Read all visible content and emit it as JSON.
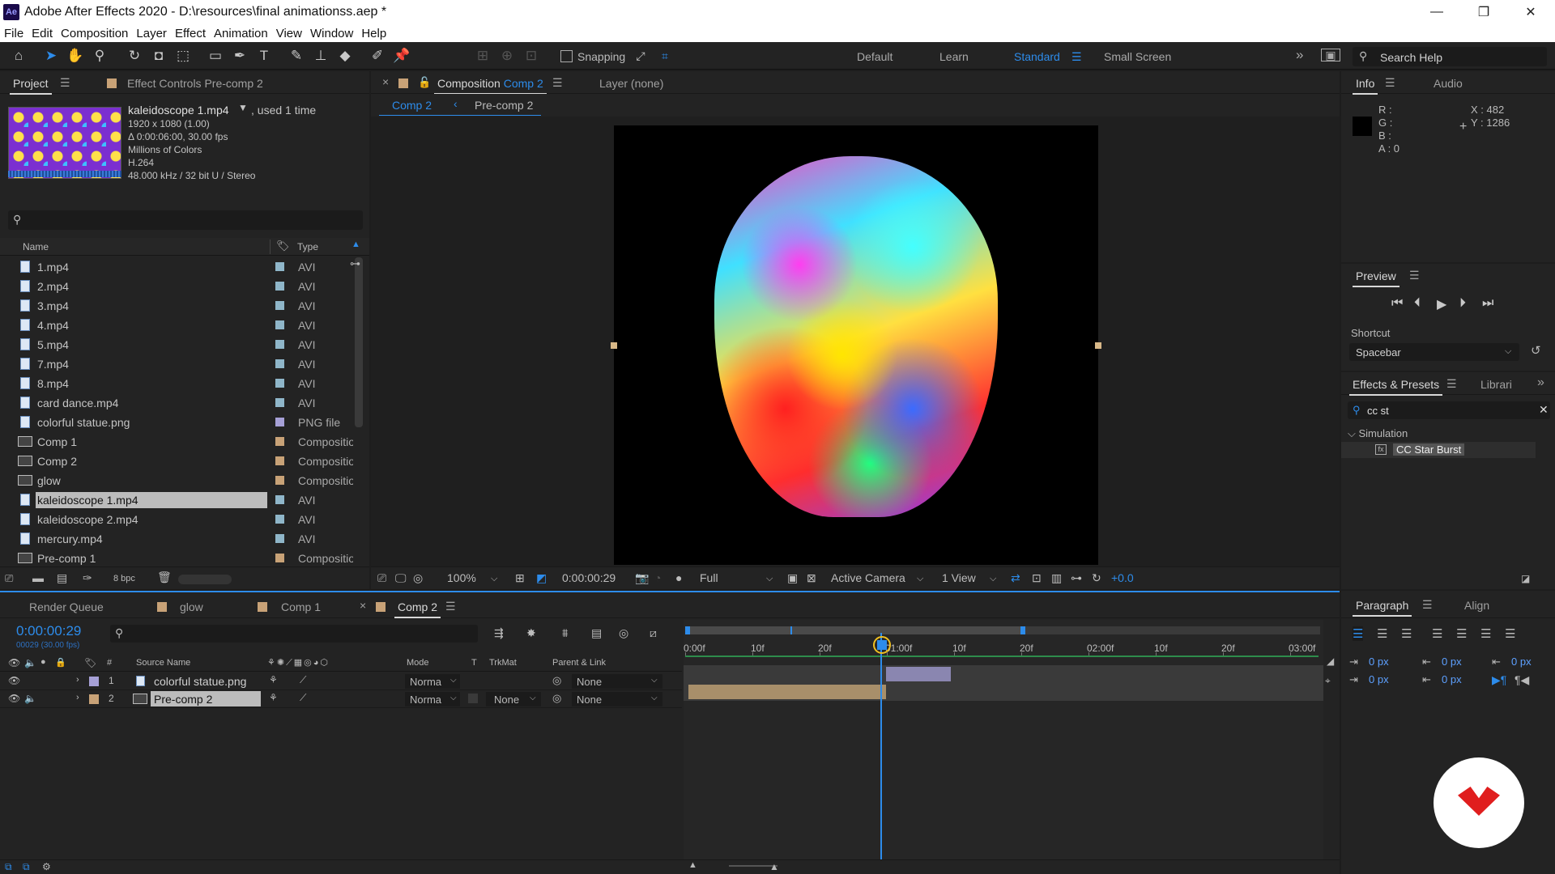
{
  "window": {
    "app_icon": "Ae",
    "title": "Adobe After Effects 2020 - D:\\resources\\final animationss.aep *",
    "minimize": "—",
    "maximize": "❐",
    "close": "✕"
  },
  "menu": [
    "File",
    "Edit",
    "Composition",
    "Layer",
    "Effect",
    "Animation",
    "View",
    "Window",
    "Help"
  ],
  "toolbar": {
    "snapping_label": "Snapping",
    "workspaces": [
      "Default",
      "Learn",
      "Standard",
      "Small Screen"
    ],
    "active_workspace": "Standard",
    "more": "»",
    "search_placeholder": "Search Help"
  },
  "project_panel": {
    "tab": "Project",
    "effect_controls_tab": "Effect Controls Pre-comp 2",
    "selected": {
      "name": "kaleidoscope 1.mp4",
      "used": ", used 1 time",
      "info": [
        "1920 x 1080 (1.00)",
        "Δ 0:00:06:00, 30.00 fps",
        "Millions of Colors",
        "H.264",
        "48.000 kHz / 32 bit U / Stereo"
      ]
    },
    "search_placeholder": "",
    "col_name": "Name",
    "col_type": "Type",
    "items": [
      {
        "name": "1.mp4",
        "type": "AVI",
        "kind": "file",
        "label": "#8fb6c9"
      },
      {
        "name": "2.mp4",
        "type": "AVI",
        "kind": "file",
        "label": "#8fb6c9"
      },
      {
        "name": "3.mp4",
        "type": "AVI",
        "kind": "file",
        "label": "#8fb6c9"
      },
      {
        "name": "4.mp4",
        "type": "AVI",
        "kind": "file",
        "label": "#8fb6c9"
      },
      {
        "name": "5.mp4",
        "type": "AVI",
        "kind": "file",
        "label": "#8fb6c9"
      },
      {
        "name": "7.mp4",
        "type": "AVI",
        "kind": "file",
        "label": "#8fb6c9"
      },
      {
        "name": "8.mp4",
        "type": "AVI",
        "kind": "file",
        "label": "#8fb6c9"
      },
      {
        "name": "card dance.mp4",
        "type": "AVI",
        "kind": "file",
        "label": "#8fb6c9"
      },
      {
        "name": "colorful statue.png",
        "type": "PNG file",
        "kind": "file",
        "label": "#a6a0d6"
      },
      {
        "name": "Comp 1",
        "type": "Composition",
        "kind": "comp",
        "label": "#c8a277"
      },
      {
        "name": "Comp 2",
        "type": "Composition",
        "kind": "comp",
        "label": "#c8a277"
      },
      {
        "name": "glow",
        "type": "Composition",
        "kind": "comp",
        "label": "#c8a277"
      },
      {
        "name": "kaleidoscope 1.mp4",
        "type": "AVI",
        "kind": "file",
        "label": "#8fb6c9",
        "selected": true
      },
      {
        "name": "kaleidoscope 2.mp4",
        "type": "AVI",
        "kind": "file",
        "label": "#8fb6c9"
      },
      {
        "name": "mercury.mp4",
        "type": "AVI",
        "kind": "file",
        "label": "#8fb6c9"
      },
      {
        "name": "Pre-comp 1",
        "type": "Composition",
        "kind": "comp",
        "label": "#c8a277"
      }
    ],
    "bpc": "8 bpc"
  },
  "comp_panel": {
    "tab_prefix": "Composition",
    "tab_comp": "Comp 2",
    "layer_tab": "Layer  (none)",
    "breadcrumbs": [
      "Comp 2",
      "Pre-comp 2"
    ],
    "zoom": "100%",
    "timecode": "0:00:00:29",
    "resolution": "Full",
    "camera": "Active Camera",
    "views": "1 View",
    "exposure": "+0.0"
  },
  "info_panel": {
    "tab": "Info",
    "audio_tab": "Audio",
    "r": "R :",
    "g": "G :",
    "b": "B :",
    "a": "A :  0",
    "x": "X : 482",
    "y": "Y : 1286"
  },
  "preview_panel": {
    "tab": "Preview",
    "shortcut_label": "Shortcut",
    "shortcut_value": "Spacebar"
  },
  "effects_panel": {
    "tab": "Effects & Presets",
    "libraries_tab": "Librari",
    "search_value": "cc st",
    "category": "Simulation",
    "effect": "CC Star Burst"
  },
  "paragraph_panel": {
    "tab": "Paragraph",
    "align_tab": "Align",
    "indent_values": [
      "0 px",
      "0 px",
      "0 px",
      "0 px",
      "0 px"
    ]
  },
  "timeline": {
    "tabs": [
      "Render Queue",
      "glow",
      "Comp 1",
      "Comp 2"
    ],
    "active_tab": "Comp 2",
    "timecode": "0:00:00:29",
    "frame_info": "00029 (30.00 fps)",
    "columns": {
      "source": "Source Name",
      "mode": "Mode",
      "t": "T",
      "trkmat": "TrkMat",
      "parent": "Parent & Link"
    },
    "ruler": [
      "0:00f",
      "10f",
      "20f",
      "01:00f",
      "10f",
      "20f",
      "02:00f",
      "10f",
      "20f",
      "03:00f"
    ],
    "layers": [
      {
        "num": "1",
        "name": "colorful statue.png",
        "mode": "Norma",
        "trkmat": "",
        "parent": "None",
        "label": "#a6a0d6"
      },
      {
        "num": "2",
        "name": "Pre-comp 2",
        "mode": "Norma",
        "trkmat": "None",
        "parent": "None",
        "label": "#c8a277"
      }
    ]
  },
  "colors": {
    "accent": "#2d8ceb",
    "selection": "#4a4a4a"
  }
}
